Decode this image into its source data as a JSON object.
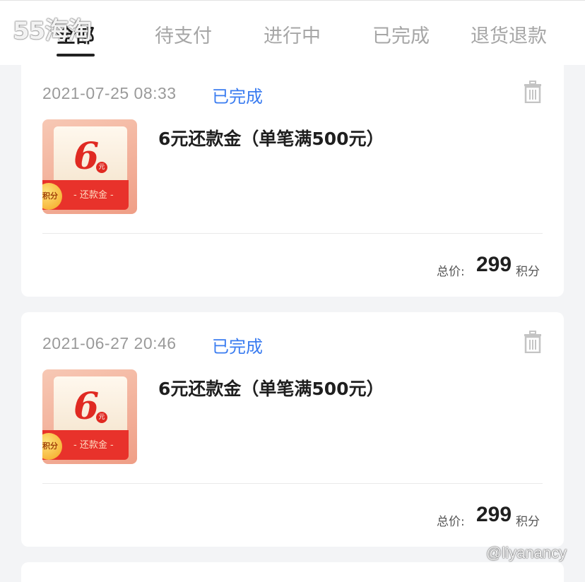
{
  "watermark": {
    "top": "55海淘",
    "bottom": "@liyanancy"
  },
  "tabs": [
    {
      "label": "全部",
      "active": true
    },
    {
      "label": "待支付",
      "active": false
    },
    {
      "label": "进行中",
      "active": false
    },
    {
      "label": "已完成",
      "active": false
    },
    {
      "label": "退货退款",
      "active": false
    }
  ],
  "orders": [
    {
      "datetime": "2021-07-25 08:33",
      "status": "已完成",
      "title": "6元还款金（单笔满500元）",
      "thumb": {
        "amount": "6",
        "currency": "元",
        "label": "- 还款金 -",
        "coin": "积分"
      },
      "total_label": "总价:",
      "total_value": "299",
      "total_unit": "积分"
    },
    {
      "datetime": "2021-06-27 20:46",
      "status": "已完成",
      "title": "6元还款金（单笔满500元）",
      "thumb": {
        "amount": "6",
        "currency": "元",
        "label": "- 还款金 -",
        "coin": "积分"
      },
      "total_label": "总价:",
      "total_value": "299",
      "total_unit": "积分"
    }
  ],
  "colors": {
    "status": "#3a7cf0",
    "accent_red": "#e02a22",
    "background": "#f3f4f6"
  },
  "icons": {
    "delete": "trash-icon"
  }
}
